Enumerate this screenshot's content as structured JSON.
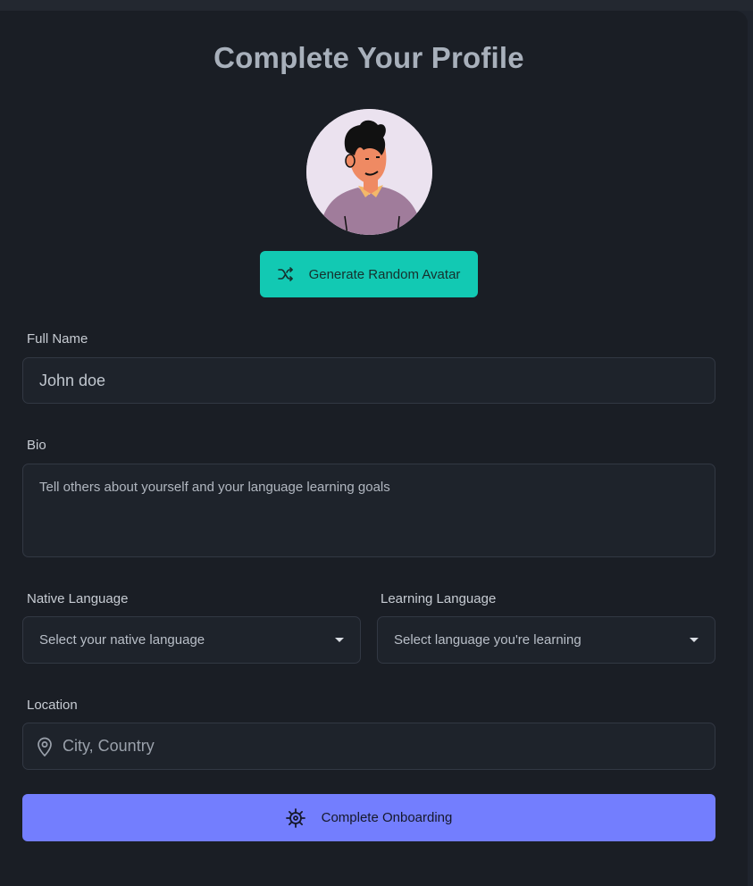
{
  "header": {
    "title": "Complete Your Profile"
  },
  "avatar": {
    "icon": "cartoon-person-avatar"
  },
  "generate_button": {
    "label": "Generate Random Avatar",
    "icon": "shuffle-icon",
    "color": "#12c9b3"
  },
  "full_name": {
    "label": "Full Name",
    "value": "John doe"
  },
  "bio": {
    "label": "Bio",
    "placeholder": "Tell others about yourself and your language learning goals"
  },
  "native_language": {
    "label": "Native Language",
    "selected": "Select your native language"
  },
  "learning_language": {
    "label": "Learning Language",
    "selected": "Select language you're learning"
  },
  "location": {
    "label": "Location",
    "placeholder": "City, Country",
    "icon": "map-pin-icon"
  },
  "submit_button": {
    "label": "Complete Onboarding",
    "icon": "ship-wheel-icon",
    "color": "#737efe"
  },
  "colors": {
    "background": "#1a1e25",
    "field": "#1e232b",
    "border": "#323843"
  }
}
